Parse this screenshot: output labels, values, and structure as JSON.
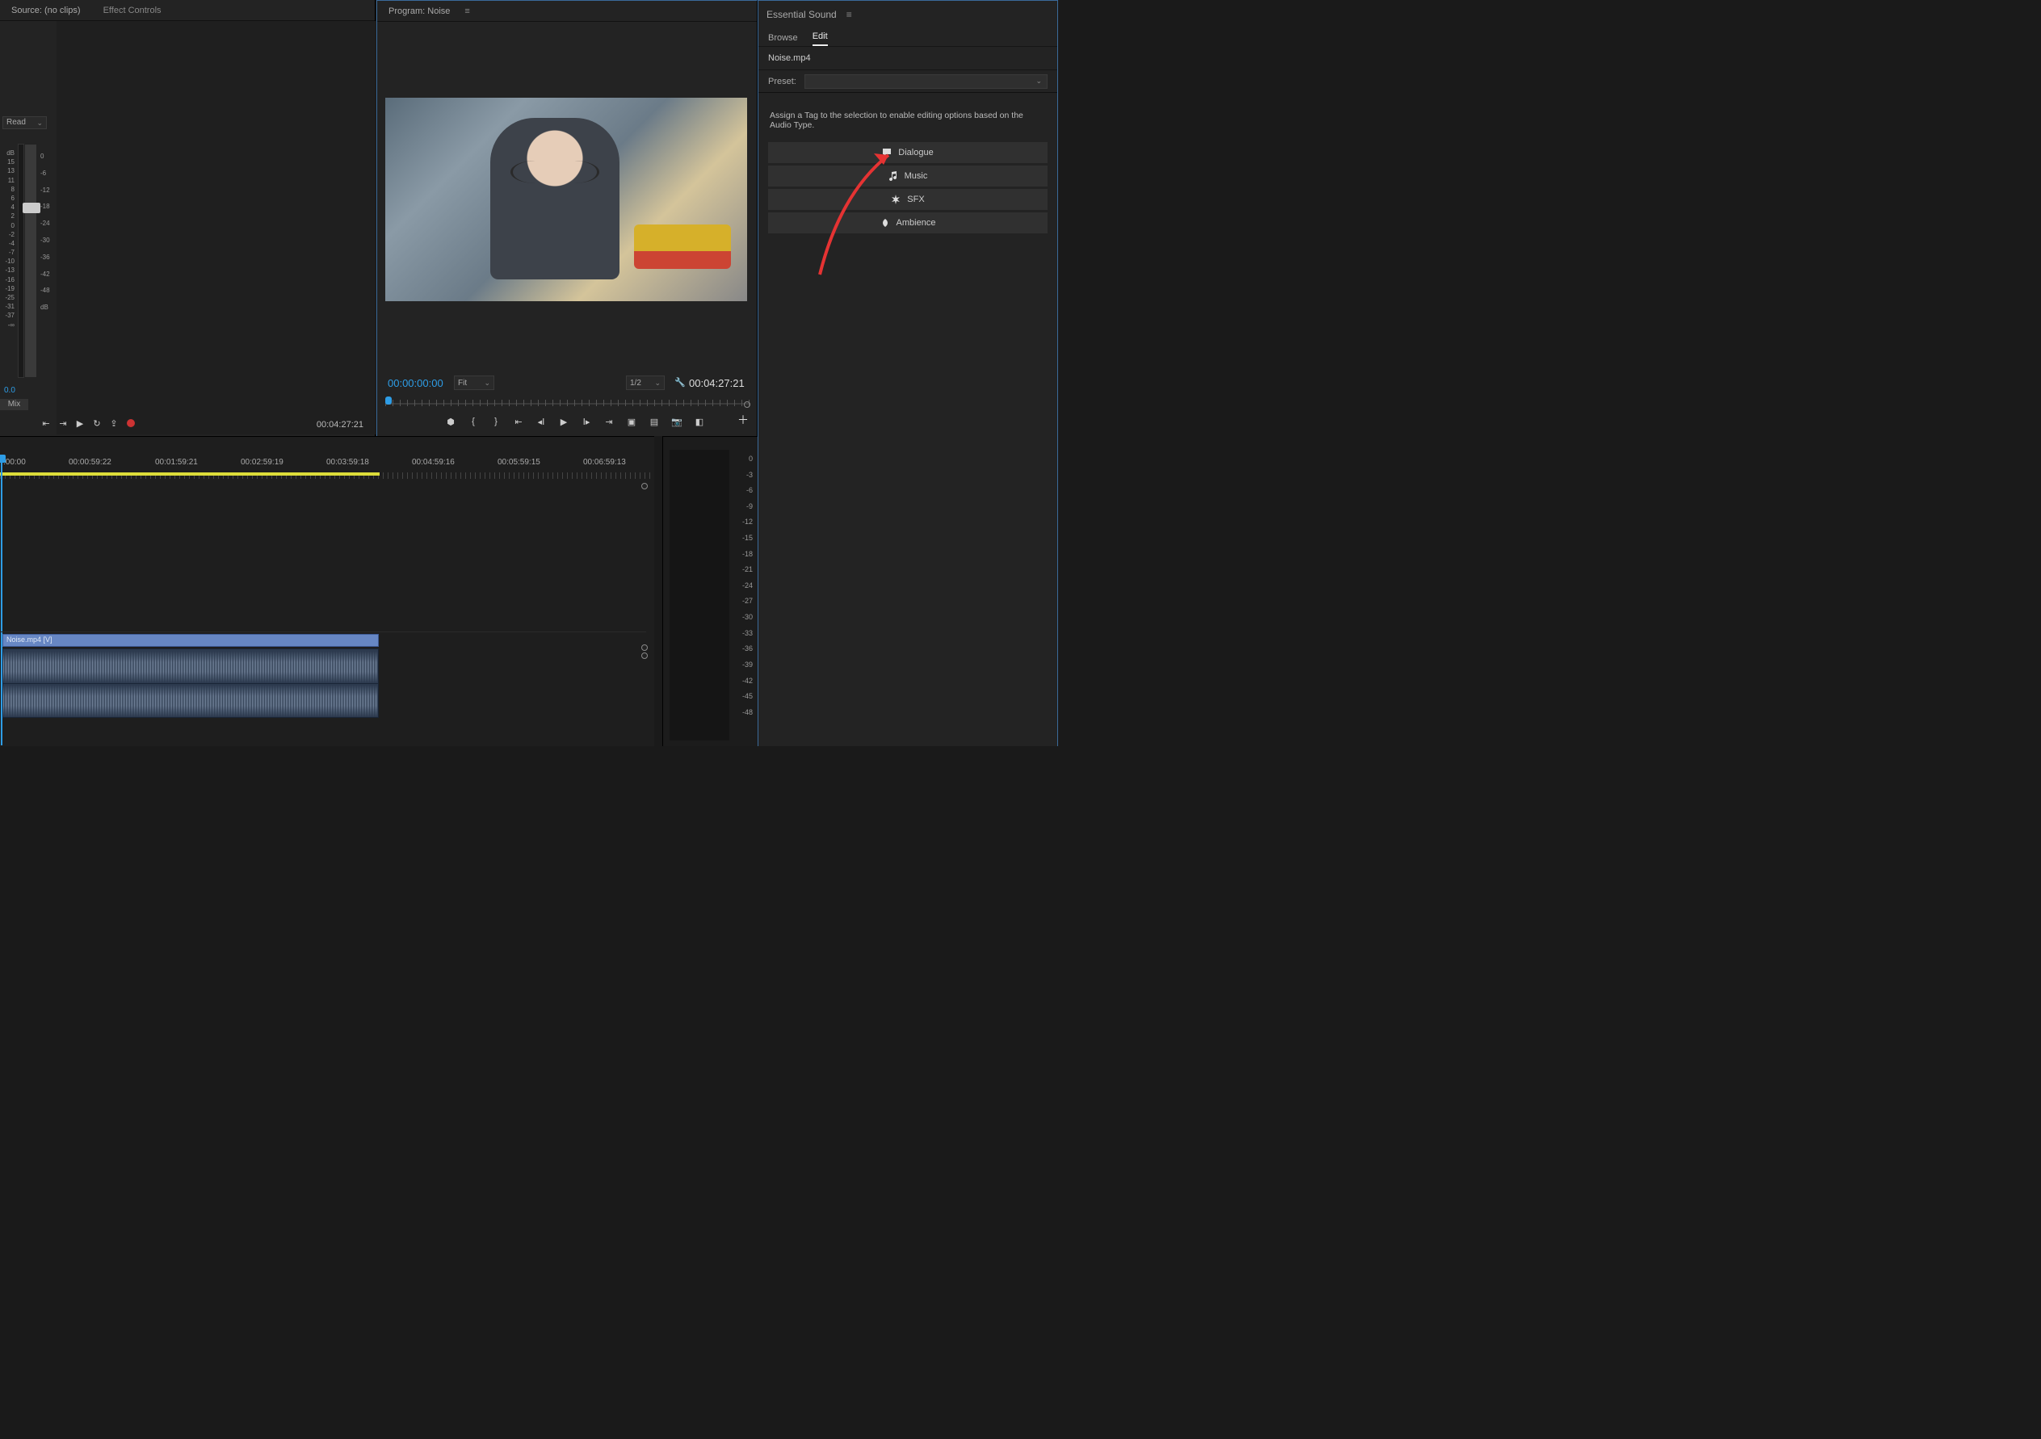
{
  "source": {
    "tab_source": "Source: (no clips)",
    "tab_effects": "Effect Controls",
    "read_mode": "Read",
    "meter_value": "0.0",
    "mix_label": "Mix",
    "db_unit_top": "dB",
    "db_unit_bot": "dB",
    "db_scale_left": [
      "15",
      "13",
      "11",
      "8",
      "6",
      "4",
      "2",
      "0",
      "-2",
      "",
      "-4",
      "",
      "-7",
      "",
      "-10",
      "-13",
      "-16",
      "-19",
      "",
      "-25",
      "-31",
      "-37",
      "-∞"
    ],
    "db_scale_right": [
      "0",
      "",
      "-6",
      "",
      "-12",
      "",
      "-18",
      "",
      "-24",
      "",
      "-30",
      "",
      "-36",
      "",
      "-42",
      "",
      "-48",
      ""
    ],
    "duration": "00:04:27:21"
  },
  "program": {
    "title": "Program: Noise",
    "timecode": "00:00:00:00",
    "fit_label": "Fit",
    "resolution": "1/2",
    "duration": "00:04:27:21"
  },
  "essentialSound": {
    "title": "Essential Sound",
    "tab_browse": "Browse",
    "tab_edit": "Edit",
    "clip_name": "Noise.mp4",
    "preset_label": "Preset:",
    "assign_text": "Assign a Tag to the selection to enable editing options based on the Audio Type.",
    "tags": {
      "dialogue": "Dialogue",
      "music": "Music",
      "sfx": "SFX",
      "ambience": "Ambience"
    }
  },
  "timeline": {
    "times": [
      ":00:00",
      "00:00:59:22",
      "00:01:59:21",
      "00:02:59:19",
      "00:03:59:18",
      "00:04:59:16",
      "00:05:59:15",
      "00:06:59:13"
    ],
    "video_clip_label": "Noise.mp4 [V]",
    "meter_scale": [
      "0",
      "-3",
      "-6",
      "-9",
      "-12",
      "-15",
      "-18",
      "-21",
      "-24",
      "-27",
      "-30",
      "-33",
      "-36",
      "-39",
      "-42",
      "-45",
      "-48"
    ]
  }
}
